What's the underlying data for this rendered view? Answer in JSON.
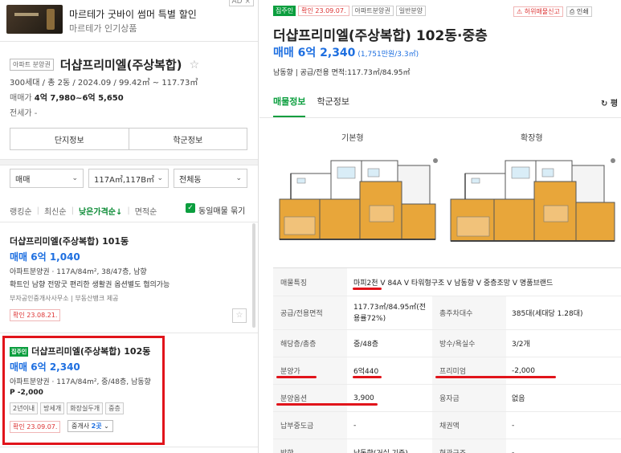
{
  "ad": {
    "title": "마르테가 굿바이 썸머 특별 할인",
    "subtitle": "마르테가 인기상품",
    "tag": "AD ×"
  },
  "complex": {
    "type_tag": "아파트 분양권",
    "name": "더샵프리미엘(주상복합)",
    "star": "☆",
    "meta": "300세대 / 총 2동 / 2024.09 / 99.42㎡ ~ 117.73㎡",
    "trade_label": "매매가",
    "trade_value": "4억 7,980~6억 5,650",
    "jeonse": "전세가 -",
    "buttons": [
      "단지정보",
      "학군정보"
    ]
  },
  "filters": {
    "type": "매매",
    "area": "117A㎡,117B㎡",
    "dong": "전체동"
  },
  "sort": {
    "items": [
      "랭킹순",
      "최신순",
      "낮은가격순↓",
      "면적순"
    ],
    "active_index": 2,
    "same_listing_label": "동일매물 묶기",
    "same_listing_checked": true
  },
  "listings": [
    {
      "title": "더샵프리미엘(주상복합) 101동",
      "price": "매매 6억 1,040",
      "desc": "아파트분양권 · 117A/84m², 38/47층, 남향",
      "desc2": "확트인 남향 전망굿 편리한 생활권 옵션별도 협의가능",
      "agent": "부자공인중개사사무소 | 부동산뱅크 제공",
      "confirm": "확인 23.08.21."
    },
    {
      "tag": "집주인",
      "title": "더샵프리미엘(주상복합) 102동",
      "price": "매매 6억 2,340",
      "desc": "아파트분양권 · 117A/84m², 중/48층, 남동향",
      "premium": "P -2,000",
      "chips": [
        "2년이내",
        "방세개",
        "화장실두개",
        "중층"
      ],
      "confirm": "확인 23.09.07.",
      "agent_count_label": "중개사",
      "agent_count": "2곳"
    }
  ],
  "detail": {
    "badges": [
      "집주인",
      "확인 23.09.07.",
      "아파트분양권",
      "일반분양"
    ],
    "report_label": "허위매물신고",
    "print_label": "인쇄",
    "title": "더샵프리미엘(주상복합) 102동·중층",
    "price": "매매 6억 2,340",
    "price_per": "(1,751만원/3.3㎡)",
    "meta": "남동향 | 공급/전용 면적:117.73㎡/84.95㎡",
    "tabs": [
      "매물정보",
      "학군정보"
    ],
    "refresh_label": "평",
    "plan_labels": [
      "기본형",
      "확장형"
    ],
    "rows": [
      {
        "k": "매물특징",
        "v": "마피2천 V 84A V 타워형구조 V 남동향 V 중층조망 V 명품브랜드"
      },
      {
        "k": "공급/전용면적",
        "v": "117.73㎡/84.95㎡(전용률72%)",
        "k2": "총주차대수",
        "v2": "385대(세대당 1.28대)"
      },
      {
        "k": "해당층/총층",
        "v": "중/48층",
        "k2": "방수/욕실수",
        "v2": "3/2개"
      },
      {
        "k": "분양가",
        "v": "6억440",
        "k2": "프리미엄",
        "v2": "-2,000"
      },
      {
        "k": "분양옵션",
        "v": "3,900",
        "k2": "융자금",
        "v2": "없음"
      },
      {
        "k": "납부중도금",
        "v": "-",
        "k2": "채권액",
        "v2": "-"
      },
      {
        "k": "방향",
        "v": "남동향(거실 기준)",
        "k2": "현관구조",
        "v2": "-"
      }
    ]
  },
  "colors": {
    "accent_green": "#0b9e3e",
    "price_blue": "#1e6fe0",
    "highlight_red": "#e1141b"
  }
}
